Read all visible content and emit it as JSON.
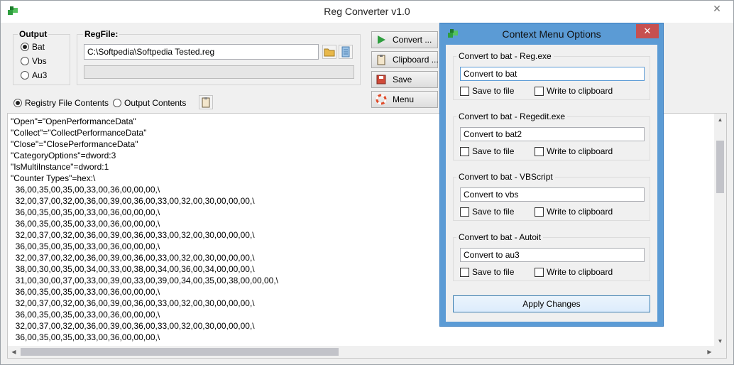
{
  "window": {
    "title": "Reg Converter v1.0",
    "close_glyph": "✕"
  },
  "output": {
    "legend": "Output",
    "options": [
      {
        "label": "Bat",
        "checked": true
      },
      {
        "label": "Vbs",
        "checked": false
      },
      {
        "label": "Au3",
        "checked": false
      }
    ]
  },
  "regfile": {
    "legend": "RegFile:",
    "path": "C:\\Softpedia\\Softpedia Tested.reg",
    "progress": 0
  },
  "view": {
    "registry_label": "Registry File Contents",
    "output_label": "Output Contents",
    "selected": "registry"
  },
  "buttons": {
    "convert": "Convert ...",
    "clipboard": "Clipboard ...",
    "save": "Save",
    "menu": "Menu"
  },
  "editor": {
    "lines": [
      "\"Open\"=\"OpenPerformanceData\"",
      "\"Collect\"=\"CollectPerformanceData\"",
      "\"Close\"=\"ClosePerformanceData\"",
      "\"CategoryOptions\"=dword:3",
      "\"IsMultiInstance\"=dword:1",
      "\"Counter Types\"=hex:\\",
      "  36,00,35,00,35,00,33,00,36,00,00,00,\\",
      "  32,00,37,00,32,00,36,00,39,00,36,00,33,00,32,00,30,00,00,00,\\",
      "  36,00,35,00,35,00,33,00,36,00,00,00,\\",
      "  36,00,35,00,35,00,33,00,36,00,00,00,\\",
      "  32,00,37,00,32,00,36,00,39,00,36,00,33,00,32,00,30,00,00,00,\\",
      "  36,00,35,00,35,00,33,00,36,00,00,00,\\",
      "  32,00,37,00,32,00,36,00,39,00,36,00,33,00,32,00,30,00,00,00,\\",
      "  38,00,30,00,35,00,34,00,33,00,38,00,34,00,36,00,34,00,00,00,\\",
      "  31,00,30,00,37,00,33,00,39,00,33,00,39,00,34,00,35,00,38,00,00,00,\\",
      "  36,00,35,00,35,00,33,00,36,00,00,00,\\",
      "  32,00,37,00,32,00,36,00,39,00,36,00,33,00,32,00,30,00,00,00,\\",
      "  36,00,35,00,35,00,33,00,36,00,00,00,\\",
      "  32,00,37,00,32,00,36,00,39,00,36,00,33,00,32,00,30,00,00,00,\\",
      "  36,00,35,00,35,00,33,00,36,00,00,00,\\"
    ]
  },
  "dialog": {
    "title": "Context Menu Options",
    "close_glyph": "✕",
    "groups": [
      {
        "legend": "Convert to bat - Reg.exe",
        "value": "Convert to bat",
        "save_label": "Save to file",
        "clip_label": "Write to clipboard"
      },
      {
        "legend": "Convert to bat - Regedit.exe",
        "value": "Convert to bat2",
        "save_label": "Save to file",
        "clip_label": "Write to clipboard"
      },
      {
        "legend": "Convert to bat - VBScript",
        "value": "Convert to vbs",
        "save_label": "Save to file",
        "clip_label": "Write to clipboard"
      },
      {
        "legend": "Convert to bat - Autoit",
        "value": "Convert to au3",
        "save_label": "Save to file",
        "clip_label": "Write to clipboard"
      }
    ],
    "apply_label": "Apply Changes"
  },
  "colors": {
    "accent": "#5b9bd5",
    "close_red": "#c75050",
    "app_icon_green": "#2e9e3e"
  }
}
